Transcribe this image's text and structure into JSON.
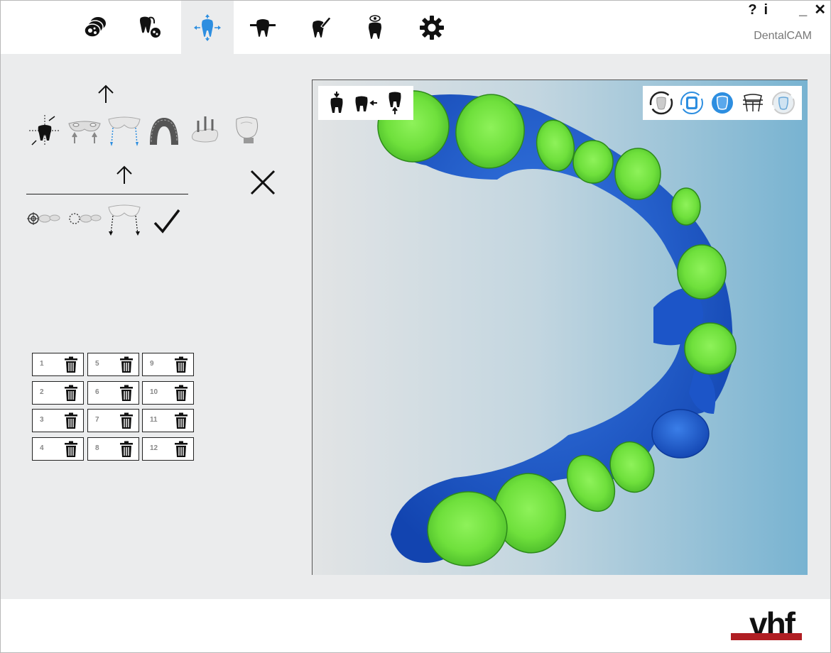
{
  "app": {
    "title": "DentalCAM"
  },
  "window_controls": {
    "help": "?",
    "info": "i",
    "minimize": "_",
    "close": "✕"
  },
  "nav": {
    "tabs": [
      {
        "icon": "job-database-icon",
        "active": false
      },
      {
        "icon": "tooth-analysis-icon",
        "active": false
      },
      {
        "icon": "tooth-positioning-icon",
        "active": true
      },
      {
        "icon": "holder-tooth-icon",
        "active": false
      },
      {
        "icon": "tooth-tool-icon",
        "active": false
      },
      {
        "icon": "tooth-preview-icon",
        "active": false
      },
      {
        "icon": "gear-icon",
        "active": false
      }
    ]
  },
  "tools": {
    "row1": [
      "coordinate-align-icon",
      "supports-icon",
      "connectors-icon",
      "arch-icon",
      "pins-icon",
      "restoration-model-icon"
    ],
    "row2": [
      "target-position-icon",
      "dotted-position-icon",
      "connector-pins-icon",
      "confirm-check-icon"
    ]
  },
  "slots": [
    {
      "num": "1"
    },
    {
      "num": "5"
    },
    {
      "num": "9"
    },
    {
      "num": "2"
    },
    {
      "num": "6"
    },
    {
      "num": "10"
    },
    {
      "num": "3"
    },
    {
      "num": "7"
    },
    {
      "num": "11"
    },
    {
      "num": "4"
    },
    {
      "num": "8"
    },
    {
      "num": "12"
    }
  ],
  "viewport": {
    "left_tools": [
      "tooth-top-view-icon",
      "tooth-side-view-icon",
      "tooth-bottom-view-icon"
    ],
    "right_tools": [
      "render-outline-icon",
      "render-solid-icon",
      "render-shaded-icon",
      "render-bridge-icon",
      "render-transparent-icon"
    ]
  },
  "colors": {
    "accent": "#2d8ee0",
    "model_blue": "#1c5fd4",
    "model_green": "#7cf04a",
    "brand_red": "#b01e23"
  },
  "footer": {
    "logo": "vhf"
  }
}
